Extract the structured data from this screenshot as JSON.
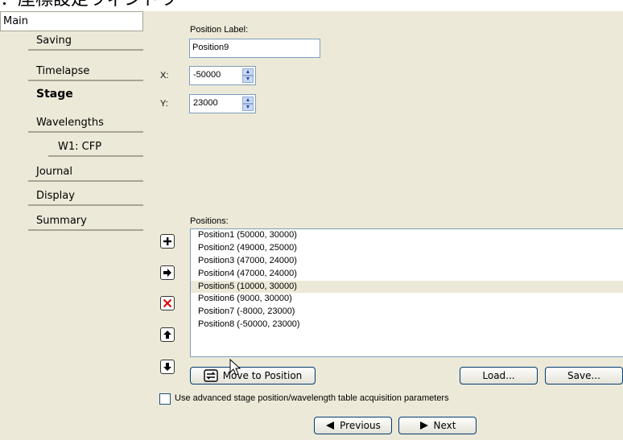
{
  "title_fragment": "：座標設定ウィンドウ",
  "nav": {
    "main": "Main",
    "items": [
      {
        "label": "Saving",
        "level": 1
      },
      {
        "label": "Timelapse",
        "level": 1
      },
      {
        "label": "Stage",
        "level": 1,
        "selected": true
      },
      {
        "label": "Wavelengths",
        "level": 1
      },
      {
        "label": "W1: CFP",
        "level": 2
      },
      {
        "label": "Journal",
        "level": 1
      },
      {
        "label": "Display",
        "level": 1
      },
      {
        "label": "Summary",
        "level": 1
      }
    ]
  },
  "position_label": {
    "label": "Position Label:",
    "value": "Position9"
  },
  "x": {
    "label": "X:",
    "value": "-50000"
  },
  "y": {
    "label": "Y:",
    "value": "23000"
  },
  "positions": {
    "label": "Positions:",
    "items": [
      "Position1 (50000, 30000)",
      "Position2 (49000, 25000)",
      "Position3 (47000, 24000)",
      "Position4 (47000, 24000)",
      "Position5 (10000, 30000)",
      "Position6 (9000, 30000)",
      "Position7 (-8000, 23000)",
      "Position8 (-50000, 23000)"
    ],
    "selected_index": 4
  },
  "icons": {
    "add": "plus-icon",
    "goto": "arrow-right-icon",
    "delete": "x-icon",
    "up": "arrow-up-icon",
    "down": "arrow-down-icon",
    "move": "stage-move-icon"
  },
  "buttons": {
    "move_to_position": "Move to Position",
    "load": "Load...",
    "save": "Save...",
    "previous": "Previous",
    "next": "Next"
  },
  "advanced_checkbox": {
    "label": "Use advanced stage position/wavelength table acquisition parameters",
    "checked": false
  },
  "colors": {
    "panel_bg": "#ece9d8",
    "delete_red": "#e00000",
    "button_border": "#003c74"
  }
}
